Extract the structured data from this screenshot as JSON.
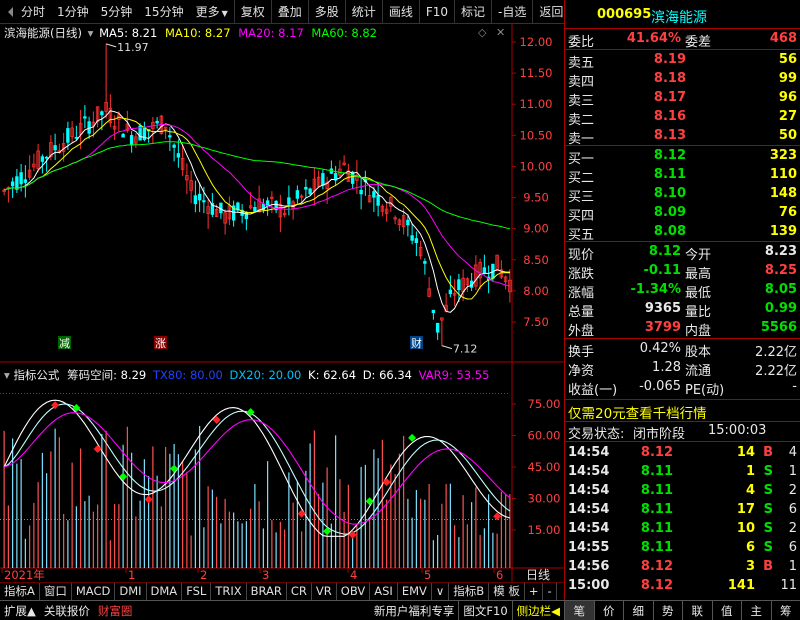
{
  "toolbar": {
    "period_buttons": [
      "分时",
      "1分钟",
      "5分钟",
      "15分钟",
      "更多"
    ],
    "tool_buttons": [
      "复权",
      "叠加",
      "多股",
      "统计",
      "画线",
      "F10",
      "标记",
      "-自选",
      "返回"
    ]
  },
  "main_chart": {
    "title": "滨海能源(日线)",
    "ma": [
      {
        "label": "MA5: 8.21",
        "color": "#ffffff"
      },
      {
        "label": "MA10: 8.27",
        "color": "#ffff00"
      },
      {
        "label": "MA20: 8.17",
        "color": "#ff00ff"
      },
      {
        "label": "MA60: 8.82",
        "color": "#00ff00"
      }
    ],
    "price_labels": [
      "12.00",
      "11.50",
      "11.00",
      "10.50",
      "10.00",
      "9.50",
      "9.00",
      "8.50",
      "8.00",
      "7.50"
    ],
    "high_annotation": "11.97",
    "low_annotation": "7.12",
    "markers": {
      "reduce": "减",
      "rise": "涨",
      "fin": "财"
    }
  },
  "sub_chart": {
    "name": "指标公式",
    "indicator": "筹码空间",
    "values": [
      {
        "label": "8.29",
        "color": "#ffffff"
      },
      {
        "label": "TX80: 80.00",
        "color": "#0000ff"
      },
      {
        "label": "DX20: 20.00",
        "color": "#00c0ff"
      },
      {
        "label": "K: 62.64",
        "color": "#ffffff"
      },
      {
        "label": "D: 66.34",
        "color": "#ffffff"
      },
      {
        "label": "VAR9: 53.55",
        "color": "#ff00ff"
      }
    ],
    "y_labels": [
      "75.00",
      "60.00",
      "45.00",
      "30.00",
      "15.00"
    ]
  },
  "x_axis": {
    "labels": [
      "2021年",
      "1",
      "2",
      "3",
      "4",
      "5",
      "6"
    ],
    "period": "日线"
  },
  "indicator_tabs": [
    "指标A",
    "窗口",
    "MACD",
    "DMI",
    "DMA",
    "FSL",
    "TRIX",
    "BRAR",
    "CR",
    "VR",
    "OBV",
    "ASI",
    "EMV",
    "∨",
    "指标B",
    "模 板",
    "+",
    "-"
  ],
  "bottom_bar": {
    "left": [
      "扩展▲",
      "关联报价",
      "财富圈"
    ],
    "promo": "新用户福利专享",
    "right_items": [
      "图文F10",
      "侧边栏◀"
    ],
    "panel_tabs": [
      "笔",
      "价",
      "细",
      "势",
      "联",
      "值",
      "主",
      "筹"
    ]
  },
  "quote": {
    "code": "000695",
    "name": "滨海能源",
    "weibi_label": "委比",
    "weibi": "41.64%",
    "weicha_label": "委差",
    "weicha": "468",
    "sell": [
      {
        "label": "卖五",
        "price": "8.19",
        "vol": "56"
      },
      {
        "label": "卖四",
        "price": "8.18",
        "vol": "99"
      },
      {
        "label": "卖三",
        "price": "8.17",
        "vol": "96"
      },
      {
        "label": "卖二",
        "price": "8.16",
        "vol": "27"
      },
      {
        "label": "卖一",
        "price": "8.13",
        "vol": "50"
      }
    ],
    "buy": [
      {
        "label": "买一",
        "price": "8.12",
        "vol": "323"
      },
      {
        "label": "买二",
        "price": "8.11",
        "vol": "110"
      },
      {
        "label": "买三",
        "price": "8.10",
        "vol": "148"
      },
      {
        "label": "买四",
        "price": "8.09",
        "vol": "76"
      },
      {
        "label": "买五",
        "price": "8.08",
        "vol": "139"
      }
    ],
    "stats": [
      {
        "l1": "现价",
        "v1": "8.12",
        "c1": "green",
        "l2": "今开",
        "v2": "8.23",
        "c2": "white"
      },
      {
        "l1": "涨跌",
        "v1": "-0.11",
        "c1": "green",
        "l2": "最高",
        "v2": "8.25",
        "c2": "red"
      },
      {
        "l1": "涨幅",
        "v1": "-1.34%",
        "c1": "green",
        "l2": "最低",
        "v2": "8.05",
        "c2": "green"
      },
      {
        "l1": "总量",
        "v1": "9365",
        "c1": "white",
        "l2": "量比",
        "v2": "0.99",
        "c2": "green"
      },
      {
        "l1": "外盘",
        "v1": "3799",
        "c1": "red",
        "l2": "内盘",
        "v2": "5566",
        "c2": "green"
      }
    ],
    "stats2": [
      {
        "l1": "换手",
        "v1": "0.42%",
        "l2": "股本",
        "v2": "2.22亿"
      },
      {
        "l1": "净资",
        "v1": "1.28",
        "l2": "流通",
        "v2": "2.22亿"
      },
      {
        "l1": "收益(一)",
        "v1": "-0.065",
        "l2": "PE(动)",
        "v2": "-"
      }
    ],
    "promo": "仅需20元查看千档行情",
    "status_label": "交易状态:",
    "status": "闭市阶段",
    "status_time": "15:00:03",
    "ticks": [
      {
        "time": "14:54",
        "price": "8.12",
        "vol": "14",
        "bs": "B",
        "n": "4"
      },
      {
        "time": "14:54",
        "price": "8.11",
        "vol": "1",
        "bs": "S",
        "n": "1"
      },
      {
        "time": "14:54",
        "price": "8.11",
        "vol": "4",
        "bs": "S",
        "n": "2"
      },
      {
        "time": "14:54",
        "price": "8.11",
        "vol": "17",
        "bs": "S",
        "n": "6"
      },
      {
        "time": "14:54",
        "price": "8.11",
        "vol": "10",
        "bs": "S",
        "n": "2"
      },
      {
        "time": "14:55",
        "price": "8.11",
        "vol": "6",
        "bs": "S",
        "n": "6"
      },
      {
        "time": "14:56",
        "price": "8.12",
        "vol": "3",
        "bs": "B",
        "n": "1"
      },
      {
        "time": "15:00",
        "price": "8.12",
        "vol": "141",
        "bs": "",
        "n": "11"
      }
    ]
  }
}
